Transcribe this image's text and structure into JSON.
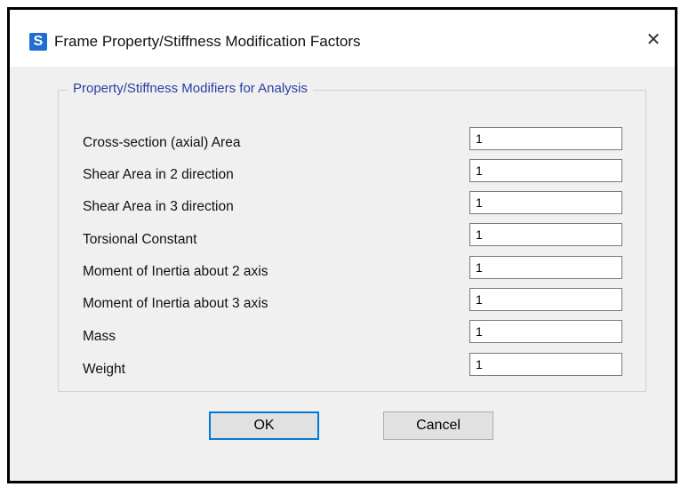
{
  "dialog": {
    "icon_text": "S",
    "title": "Frame Property/Stiffness Modification Factors",
    "close_glyph": "✕"
  },
  "group": {
    "title": "Property/Stiffness Modifiers for Analysis",
    "rows": [
      {
        "label": "Cross-section (axial) Area",
        "value": "1"
      },
      {
        "label": "Shear Area in 2 direction",
        "value": "1"
      },
      {
        "label": "Shear Area in 3 direction",
        "value": "1"
      },
      {
        "label": "Torsional Constant",
        "value": "1"
      },
      {
        "label": "Moment of Inertia about 2 axis",
        "value": "1"
      },
      {
        "label": "Moment of Inertia about 3 axis",
        "value": "1"
      },
      {
        "label": "Mass",
        "value": "1"
      },
      {
        "label": "Weight",
        "value": "1"
      }
    ]
  },
  "buttons": {
    "ok": "OK",
    "cancel": "Cancel"
  },
  "colors": {
    "app_icon": "#1e6fd0",
    "group_title": "#2a3fa0",
    "default_button_border": "#0078d7"
  }
}
